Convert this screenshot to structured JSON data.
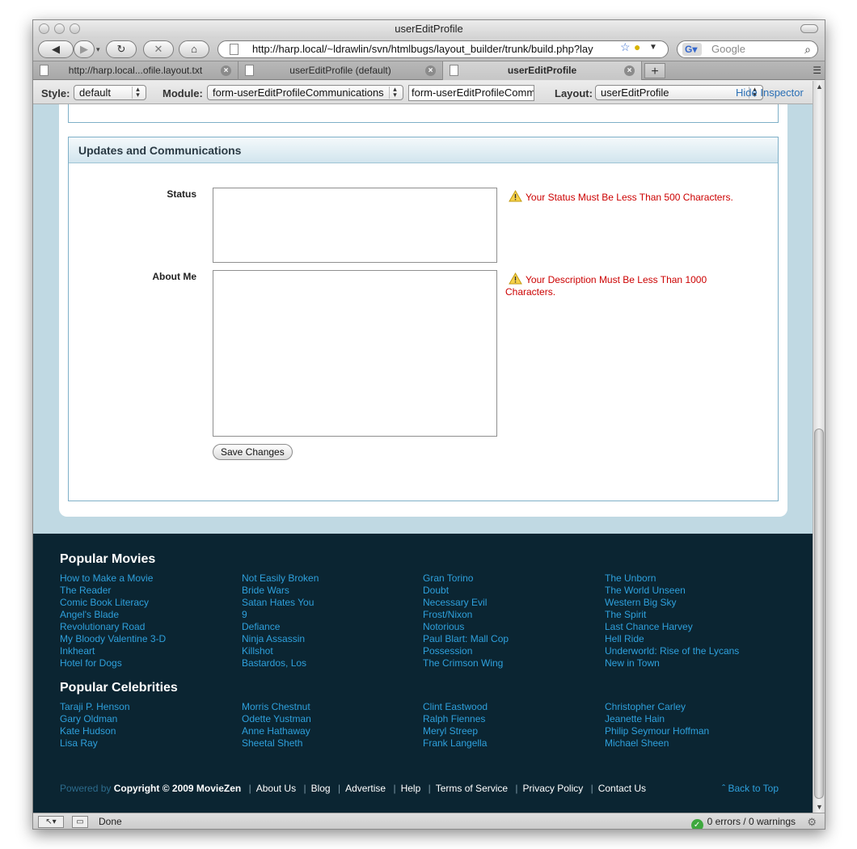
{
  "window": {
    "title": "userEditProfile"
  },
  "toolbar": {
    "url": "http://harp.local/~ldrawlin/svn/htmlbugs/layout_builder/trunk/build.php?lay",
    "search_placeholder": "Google"
  },
  "tabs": [
    {
      "label": "http://harp.local...ofile.layout.txt"
    },
    {
      "label": "userEditProfile (default)"
    },
    {
      "label": "userEditProfile"
    }
  ],
  "inspector": {
    "style_label": "Style:",
    "style_value": "default",
    "module_label": "Module:",
    "module_value": "form-userEditProfileCommunications",
    "module_input": "form-userEditProfileComm",
    "layout_label": "Layout:",
    "layout_value": "userEditProfile",
    "hide_label": "Hide Inspector"
  },
  "form": {
    "section_title": "Updates and Communications",
    "status_label": "Status",
    "status_error": "Your Status Must Be Less Than 500 Characters.",
    "about_label": "About Me",
    "about_error": "Your Description Must Be Less Than 1000 Characters.",
    "save_label": "Save Changes"
  },
  "footer": {
    "movies_heading": "Popular Movies",
    "movies": [
      [
        "How to Make a Movie",
        "The Reader",
        "Comic Book Literacy",
        "Angel's Blade",
        "Revolutionary Road",
        "My Bloody Valentine 3-D",
        "Inkheart",
        "Hotel for Dogs"
      ],
      [
        "Not Easily Broken",
        "Bride Wars",
        "Satan Hates You",
        "9",
        "Defiance",
        "Ninja Assassin",
        "Killshot",
        "Bastardos, Los"
      ],
      [
        "Gran Torino",
        "Doubt",
        "Necessary Evil",
        "Frost/Nixon",
        "Notorious",
        "Paul Blart: Mall Cop",
        "Possession",
        "The Crimson Wing"
      ],
      [
        "The Unborn",
        "The World Unseen",
        "Western Big Sky",
        "The Spirit",
        "Last Chance Harvey",
        "Hell Ride",
        "Underworld: Rise of the Lycans",
        "New in Town"
      ]
    ],
    "celebs_heading": "Popular Celebrities",
    "celebs": [
      [
        "Taraji P. Henson",
        "Gary Oldman",
        "Kate Hudson",
        "Lisa Ray"
      ],
      [
        "Morris Chestnut",
        "Odette Yustman",
        "Anne Hathaway",
        "Sheetal Sheth"
      ],
      [
        "Clint Eastwood",
        "Ralph Fiennes",
        "Meryl Streep",
        "Frank Langella"
      ],
      [
        "Christopher Carley",
        "Jeanette Hain",
        "Philip Seymour Hoffman",
        "Michael Sheen"
      ]
    ],
    "powered_by": "Powered by",
    "copyright": "Copyright © 2009 MovieZen",
    "links": [
      "About Us",
      "Blog",
      "Advertise",
      "Help",
      "Terms of Service",
      "Privacy Policy",
      "Contact Us"
    ],
    "back_to_top": "ˆ Back to Top"
  },
  "statusbar": {
    "status": "Done",
    "validation": "0 errors / 0 warnings"
  },
  "colors": {
    "link": "#2ea0dc",
    "error": "#cc0000",
    "footer_bg": "#0b2532",
    "page_bg": "#c0d9e3"
  }
}
